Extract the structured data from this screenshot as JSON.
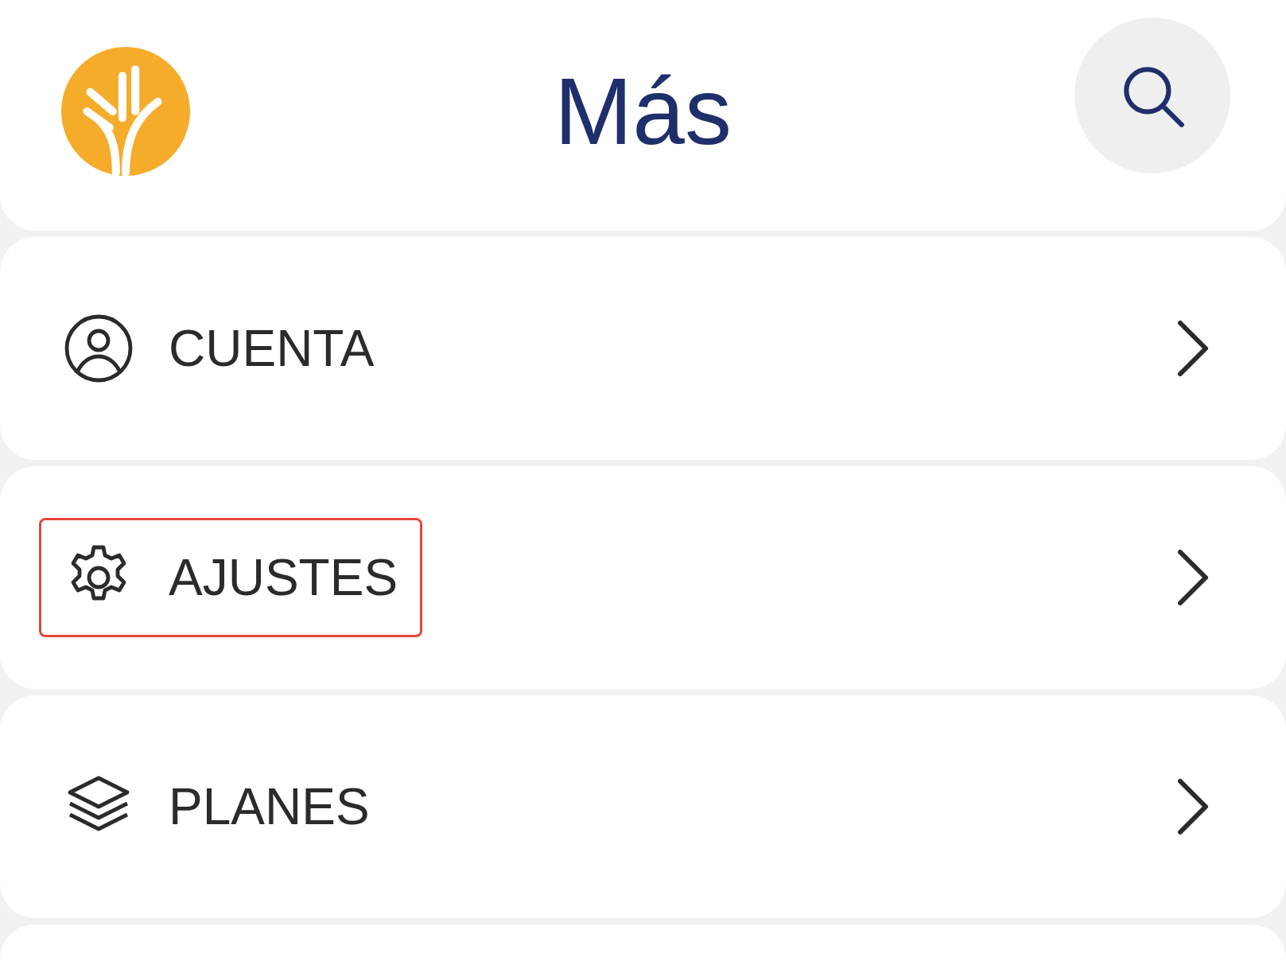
{
  "header": {
    "title": "Más"
  },
  "menu_items": [
    {
      "kind": "account",
      "label": "CUENTA",
      "highlighted": false
    },
    {
      "kind": "settings",
      "label": "AJUSTES",
      "highlighted": true
    },
    {
      "kind": "plans",
      "label": "PLANES",
      "highlighted": false
    }
  ]
}
